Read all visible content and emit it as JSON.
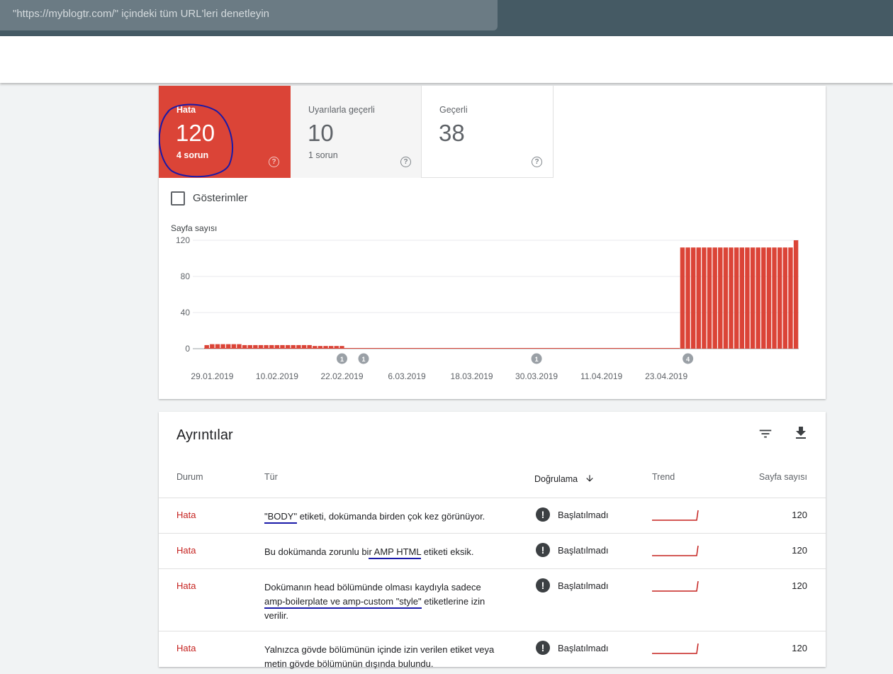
{
  "search": {
    "text": "\"https://myblogtr.com/\" içindeki tüm URL'leri denetleyin"
  },
  "tiles": [
    {
      "label": "Hata",
      "count": "120",
      "sub": "4 sorun"
    },
    {
      "label": "Uyarılarla geçerli",
      "count": "10",
      "sub": "1 sorun"
    },
    {
      "label": "Geçerli",
      "count": "38",
      "sub": ""
    }
  ],
  "help_icon": "help-circle-icon",
  "impressions_label": "Gösterimler",
  "colors": {
    "error": "#db4437",
    "warning_bg": "#f5f5f5",
    "topbar": "#455a64",
    "annotation": "#1a1aa8"
  },
  "chart_data": {
    "type": "bar",
    "ylabel": "Sayfa sayısı",
    "yticks": [
      0,
      40,
      80,
      120
    ],
    "ylim": [
      0,
      120
    ],
    "xticks": [
      "29.01.2019",
      "10.02.2019",
      "22.02.2019",
      "6.03.2019",
      "18.03.2019",
      "30.03.2019",
      "11.04.2019",
      "23.04.2019"
    ],
    "x_start": "2019-01-28",
    "values": [
      4,
      5,
      5,
      5,
      5,
      5,
      5,
      4,
      4,
      4,
      4,
      4,
      4,
      4,
      4,
      4,
      4,
      4,
      4,
      4,
      3,
      3,
      3,
      3,
      3,
      3,
      0,
      0,
      0,
      0,
      0,
      0,
      0,
      0,
      0,
      0,
      0,
      0,
      0,
      0,
      0,
      0,
      0,
      0,
      0,
      0,
      0,
      0,
      0,
      0,
      0,
      0,
      0,
      0,
      0,
      0,
      0,
      0,
      0,
      0,
      0,
      0,
      0,
      0,
      0,
      0,
      0,
      0,
      0,
      0,
      0,
      0,
      0,
      0,
      0,
      0,
      0,
      0,
      0,
      0,
      0,
      0,
      0,
      0,
      0,
      0,
      0,
      0,
      112,
      112,
      112,
      112,
      112,
      112,
      112,
      112,
      112,
      112,
      112,
      112,
      112,
      112,
      112,
      112,
      112,
      112,
      112,
      112,
      112,
      120
    ],
    "annotations": [
      {
        "date": "22.02.2019",
        "label": "1"
      },
      {
        "date": "26.02.2019",
        "label": "1"
      },
      {
        "date": "30.03.2019",
        "label": "1"
      },
      {
        "date": "27.04.2019",
        "label": "4"
      }
    ],
    "grid": true
  },
  "details": {
    "title": "Ayrıntılar",
    "filter_icon": "filter-icon",
    "download_icon": "download-icon",
    "columns": [
      "Durum",
      "Tür",
      "Doğrulama",
      "Trend",
      "Sayfa sayısı"
    ],
    "sort_icon": "arrow-down-icon",
    "rows": [
      {
        "status": "Hata",
        "type_parts": [
          "\"BODY\"",
          " etiketi, dokümanda birden çok kez görünüyor."
        ],
        "validation": "Başlatılmadı",
        "count": "120"
      },
      {
        "status": "Hata",
        "type_parts": [
          "Bu dokümanda zorunlu bi",
          "r AMP HTML",
          " etiketi eksik."
        ],
        "validation": "Başlatılmadı",
        "count": "120"
      },
      {
        "status": "Hata",
        "type_parts": [
          "Dokümanın head bölümünde olması kaydıyla sadece ",
          "amp-boilerplate ve amp-custom \"style\"",
          " etiketlerine izin verilir."
        ],
        "validation": "Başlatılmadı",
        "count": "120"
      },
      {
        "status": "Hata",
        "type_parts": [
          "Yalnızca gövde bölümünün içinde izin verilen etiket",
          "veya metin gövde bölümünün dışında bulundu."
        ],
        "validation": "Başlatılmadı",
        "count": "120"
      }
    ]
  }
}
